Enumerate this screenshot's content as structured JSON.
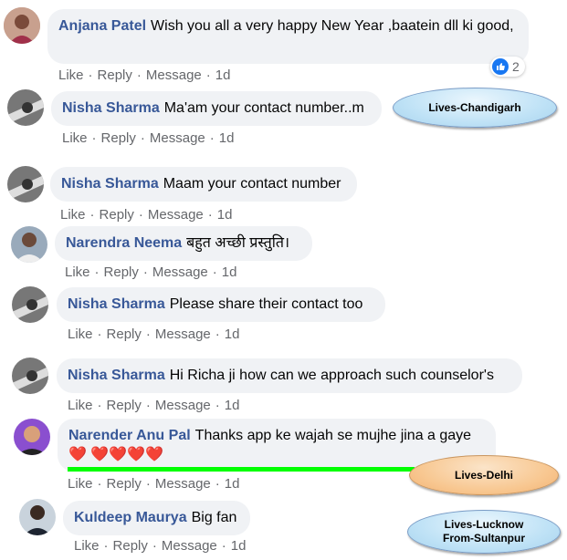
{
  "comments": [
    {
      "name": "Anjana Patel",
      "text": "Wish you all a very happy New Year ,baatein dll ki good,",
      "actions": [
        "Like",
        "Reply",
        "Message",
        "1d"
      ],
      "reaction_count": "2",
      "reaction_icon": "like-icon"
    },
    {
      "name": "Nisha Sharma",
      "text": "Ma'am your contact number..m",
      "actions": [
        "Like",
        "Reply",
        "Message",
        "1d"
      ]
    },
    {
      "name": "Nisha Sharma",
      "text": "Maam your contact number",
      "actions": [
        "Like",
        "Reply",
        "Message",
        "1d"
      ]
    },
    {
      "name": "Narendra Neema",
      "text": "बहुत अच्छी प्रस्तुति।",
      "actions": [
        "Like",
        "Reply",
        "Message",
        "1d"
      ]
    },
    {
      "name": "Nisha Sharma",
      "text": "Please share their contact too",
      "actions": [
        "Like",
        "Reply",
        "Message",
        "1d"
      ]
    },
    {
      "name": "Nisha Sharma",
      "text": "Hi Richa ji how can we approach such counselor's",
      "actions": [
        "Like",
        "Reply",
        "Message",
        "1d"
      ]
    },
    {
      "name": "Narender Anu Pal",
      "text": "Thanks app ke wajah se mujhe jina a gaye",
      "hearts": "❤️ ❤️❤️❤️❤️",
      "actions": [
        "Like",
        "Reply",
        "Message",
        "1d"
      ]
    },
    {
      "name": "Kuldeep Maurya",
      "text": "Big fan",
      "actions": [
        "Like",
        "Reply",
        "Message",
        "1d"
      ]
    }
  ],
  "annotations": {
    "chandigarh": "Lives-Chandigarh",
    "delhi": "Lives-Delhi",
    "lucknow_line1": "Lives-Lucknow",
    "lucknow_line2": "From-Sultanpur"
  },
  "colors": {
    "name": "#385898",
    "bubble": "#f0f2f5",
    "meta": "#65676b",
    "heart": "#e0245e",
    "highlight": "#00ff00"
  }
}
